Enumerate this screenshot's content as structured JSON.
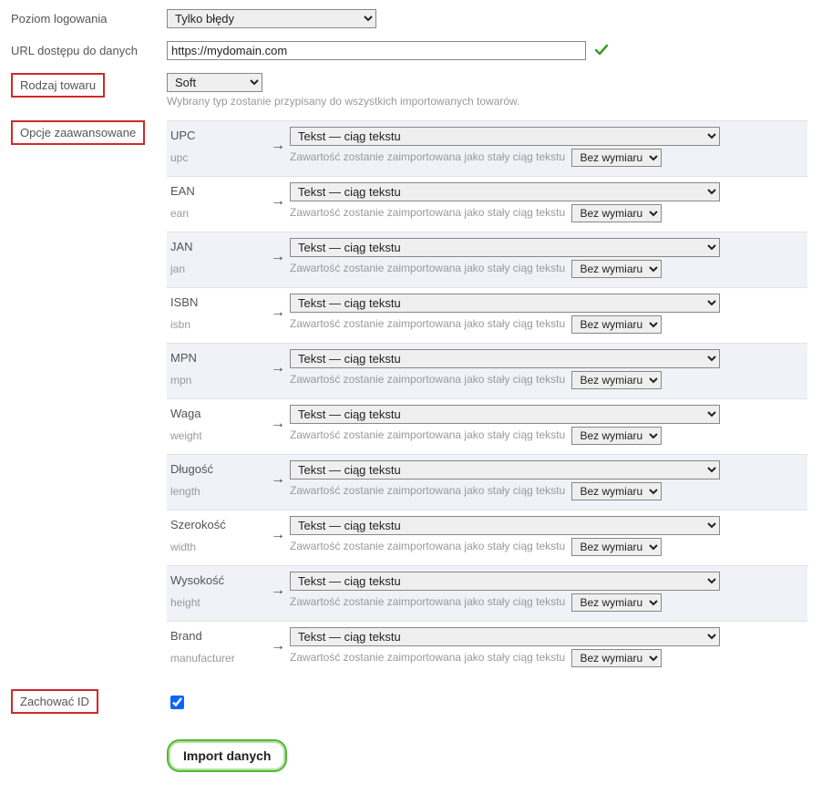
{
  "labels": {
    "logging": "Poziom logowania",
    "url": "URL dostępu do danych",
    "goods_type": "Rodzaj towaru",
    "advanced": "Opcje zaawansowane",
    "keep_id": "Zachować ID"
  },
  "logging_value": "Tylko błędy",
  "url_value": "https://mydomain.com",
  "goods_type_value": "Soft",
  "goods_type_hint": "Wybrany typ zostanie przypisany do wszystkich importowanych towarów.",
  "field_type_value": "Tekst — ciąg tekstu",
  "field_hint": "Zawartość zostanie zaimportowana jako stały ciąg tekstu",
  "dimension_value": "Bez wymiaru",
  "arrow": "→",
  "import_button": "Import danych",
  "keep_id_checked": true,
  "fields": [
    {
      "label": "UPC",
      "sub": "upc"
    },
    {
      "label": "EAN",
      "sub": "ean"
    },
    {
      "label": "JAN",
      "sub": "jan"
    },
    {
      "label": "ISBN",
      "sub": "isbn"
    },
    {
      "label": "MPN",
      "sub": "mpn"
    },
    {
      "label": "Waga",
      "sub": "weight"
    },
    {
      "label": "Długość",
      "sub": "length"
    },
    {
      "label": "Szerokość",
      "sub": "width"
    },
    {
      "label": "Wysokość",
      "sub": "height"
    },
    {
      "label": "Brand",
      "sub": "manufacturer"
    }
  ]
}
